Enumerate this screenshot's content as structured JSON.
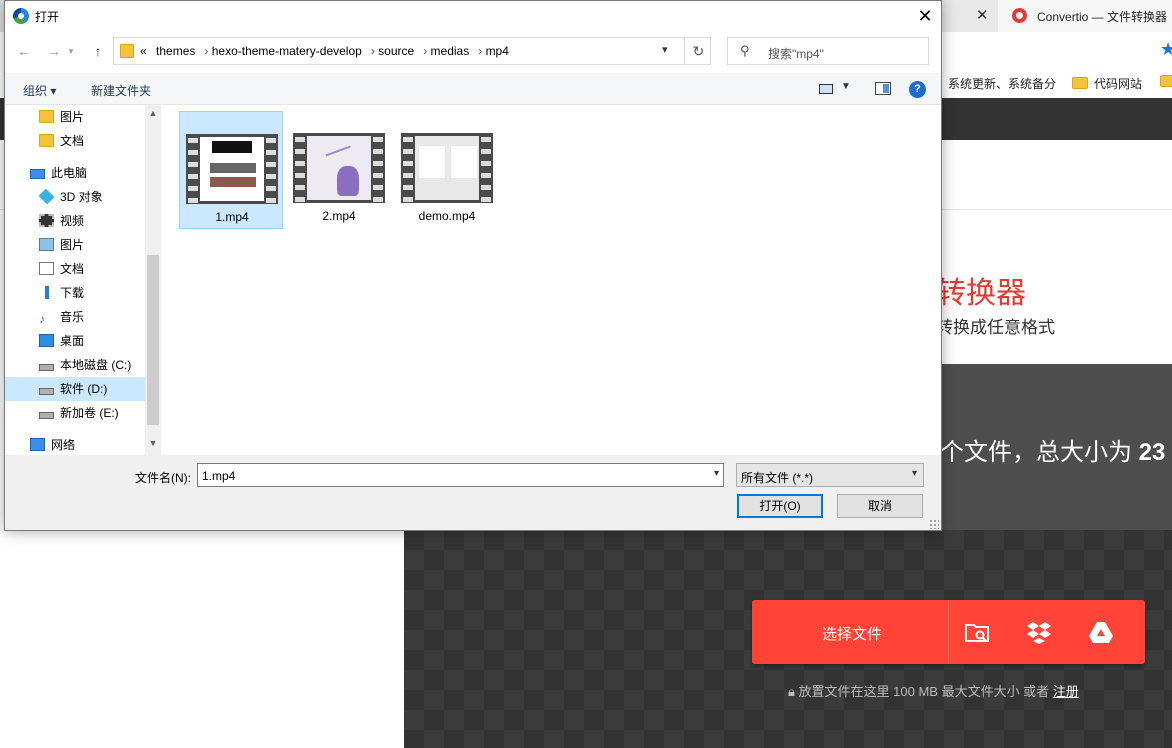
{
  "background": {
    "tabs": [
      {
        "close": "✕"
      },
      {
        "title": "Convertio — 文件转换器"
      }
    ],
    "bookmarks": [
      {
        "label": "系统更新、系统备分"
      },
      {
        "label": "代码网站"
      }
    ],
    "hero_title": "转换器",
    "hero_subtitle": "转换成任意格式",
    "files_text": "个文件，总大小为",
    "files_size": "23",
    "choose_files_label": "选择文件",
    "note_text": "放置文件在这里 100 MB 最大文件大小 或者",
    "note_link": "注册",
    "colors": {
      "accent": "#ff4336",
      "dark": "#333333",
      "grey": "#4e4e4e"
    }
  },
  "dialog": {
    "title": "打开",
    "close_icon": "✕",
    "nav": {
      "back": "←",
      "forward": "→",
      "up": "↑"
    },
    "breadcrumb_prefix": "«",
    "breadcrumb": [
      "themes",
      "hexo-theme-matery-develop",
      "source",
      "medias",
      "mp4"
    ],
    "search_placeholder": "搜索\"mp4\"",
    "toolbar": {
      "organize": "组织 ▾",
      "new_folder": "新建文件夹",
      "help": "?"
    },
    "tree": [
      {
        "label": "图片",
        "icon": "folder-icon"
      },
      {
        "label": "文档",
        "icon": "folder-icon"
      },
      {
        "label": "此电脑",
        "icon": "computer-icon"
      },
      {
        "label": "3D 对象",
        "icon": "3d-objects-icon"
      },
      {
        "label": "视频",
        "icon": "video-icon"
      },
      {
        "label": "图片",
        "icon": "pictures-icon"
      },
      {
        "label": "文档",
        "icon": "documents-icon"
      },
      {
        "label": "下载",
        "icon": "download-icon"
      },
      {
        "label": "音乐",
        "icon": "music-icon"
      },
      {
        "label": "桌面",
        "icon": "desktop-icon"
      },
      {
        "label": "本地磁盘 (C:)",
        "icon": "drive-icon"
      },
      {
        "label": "软件 (D:)",
        "icon": "drive-icon",
        "selected": true
      },
      {
        "label": "新加卷 (E:)",
        "icon": "drive-icon"
      },
      {
        "label": "网络",
        "icon": "network-icon"
      }
    ],
    "files": [
      {
        "name": "1.mp4",
        "selected": true
      },
      {
        "name": "2.mp4",
        "selected": false
      },
      {
        "name": "demo.mp4",
        "selected": false
      }
    ],
    "filename_label": "文件名(N):",
    "filename_value": "1.mp4",
    "filetype_value": "所有文件 (*.*)",
    "open_button": "打开(O)",
    "cancel_button": "取消"
  }
}
